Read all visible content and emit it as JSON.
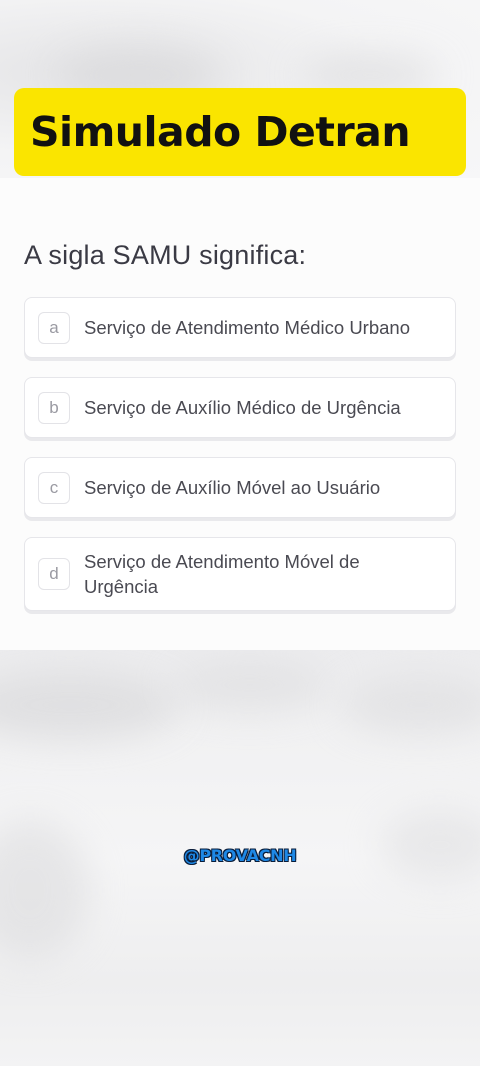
{
  "header": {
    "title": "Simulado Detran"
  },
  "quiz": {
    "question": "A sigla SAMU significa:",
    "options": [
      {
        "letter": "a",
        "text": "Serviço de Atendimento Médico Urbano"
      },
      {
        "letter": "b",
        "text": "Serviço de Auxílio Médico de Urgência"
      },
      {
        "letter": "c",
        "text": "Serviço de Auxílio Móvel ao Usuário"
      },
      {
        "letter": "d",
        "text": "Serviço de Atendimento Móvel de Urgência"
      }
    ]
  },
  "watermark": {
    "handle": "@PROVACNH"
  },
  "colors": {
    "banner": "#fae500",
    "watermark": "#1e88e5"
  }
}
